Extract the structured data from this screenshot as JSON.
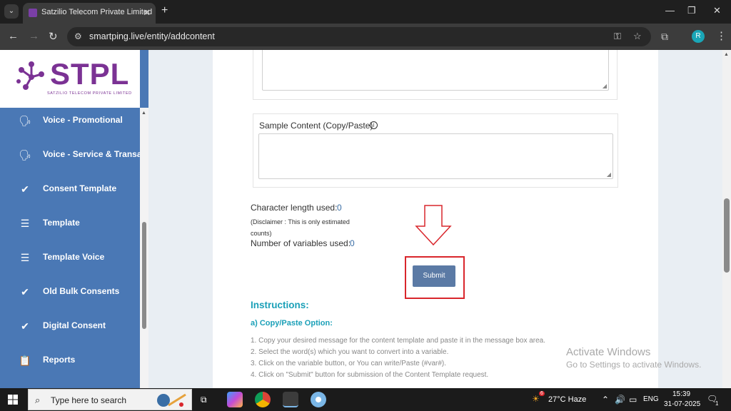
{
  "browser": {
    "tab_title": "Satzilio Telecom Private Limited",
    "url": "smartping.live/entity/addcontent",
    "profile_initial": "R"
  },
  "logo": {
    "text": "STPL",
    "subtitle": "SATZILIO TELECOM PRIVATE LIMITED"
  },
  "sidebar": {
    "items": [
      {
        "label": "Voice - Promotional",
        "icon": "voice-icon"
      },
      {
        "label": "Voice - Service & Transactional",
        "icon": "voice-icon"
      },
      {
        "label": "Consent Template",
        "icon": "check-circle-icon"
      },
      {
        "label": "Template",
        "icon": "list-icon"
      },
      {
        "label": "Template Voice",
        "icon": "list-icon"
      },
      {
        "label": "Old Bulk Consents",
        "icon": "check-circle-icon"
      },
      {
        "label": "Digital Consent",
        "icon": "check-circle-icon"
      },
      {
        "label": "Reports",
        "icon": "clipboard-icon"
      }
    ]
  },
  "form": {
    "sample_label": "Sample Content (Copy/Paste)",
    "char_length_label": "Character length used:",
    "char_length_value": "0",
    "disclaimer": "(Disclaimer : This is only estimated counts)",
    "variables_label": "Number of variables used:",
    "variables_value": "0",
    "submit_label": "Submit"
  },
  "instructions": {
    "title": "Instructions:",
    "subtitle": "a) Copy/Paste Option:",
    "lines": [
      "1. Copy your desired message for the content template and paste it in the message box area.",
      "2. Select the word(s) which you want to convert into a variable.",
      "3. Click on the variable button, or You can write/Paste (#var#).",
      "4. Click on \"Submit\" button for submission of the Content Template request."
    ]
  },
  "watermark": {
    "line1": "Activate Windows",
    "line2": "Go to Settings to activate Windows."
  },
  "taskbar": {
    "search_placeholder": "Type here to search",
    "weather": "27°C  Haze",
    "weather_badge": "6",
    "language": "ENG",
    "time": "15:39",
    "date": "31-07-2025",
    "notification_count": "1"
  },
  "colors": {
    "sidebar": "#4a78b5",
    "brand": "#7b3294",
    "accent": "#1ba0b8",
    "submit": "#5b7aa5",
    "highlight": "#d9262c"
  }
}
